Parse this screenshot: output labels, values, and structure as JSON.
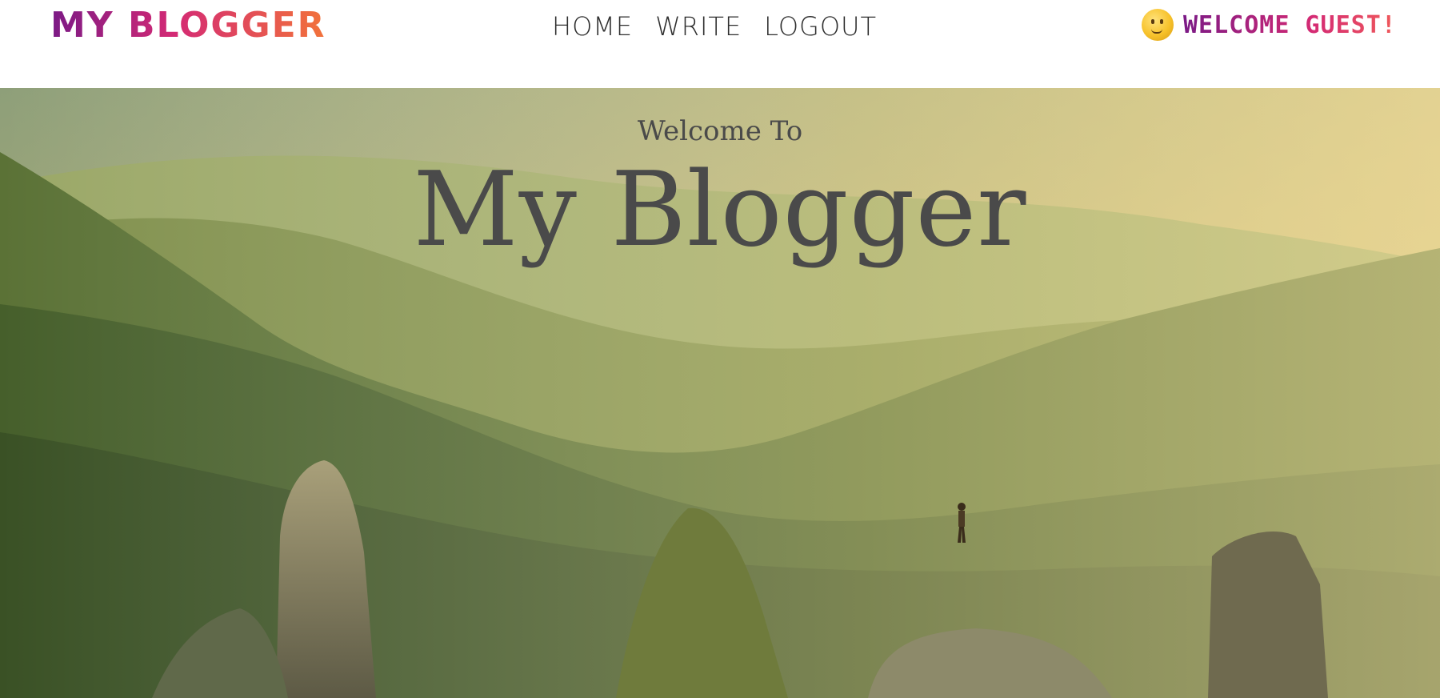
{
  "header": {
    "logo": "MY BLOGGER",
    "nav": [
      "HOME",
      "WRITE",
      "LOGOUT"
    ],
    "welcome": "WELCOME GUEST!"
  },
  "hero": {
    "subtitle": "Welcome To",
    "title": "My Blogger"
  },
  "colors": {
    "logo_gradient": [
      "#7b1a86",
      "#d42a74",
      "#f2733a"
    ],
    "nav_text": "#2e2e2e",
    "hero_text": "#4a4a4a"
  },
  "icons": {
    "user_emoji": "smiling-face-icon"
  }
}
